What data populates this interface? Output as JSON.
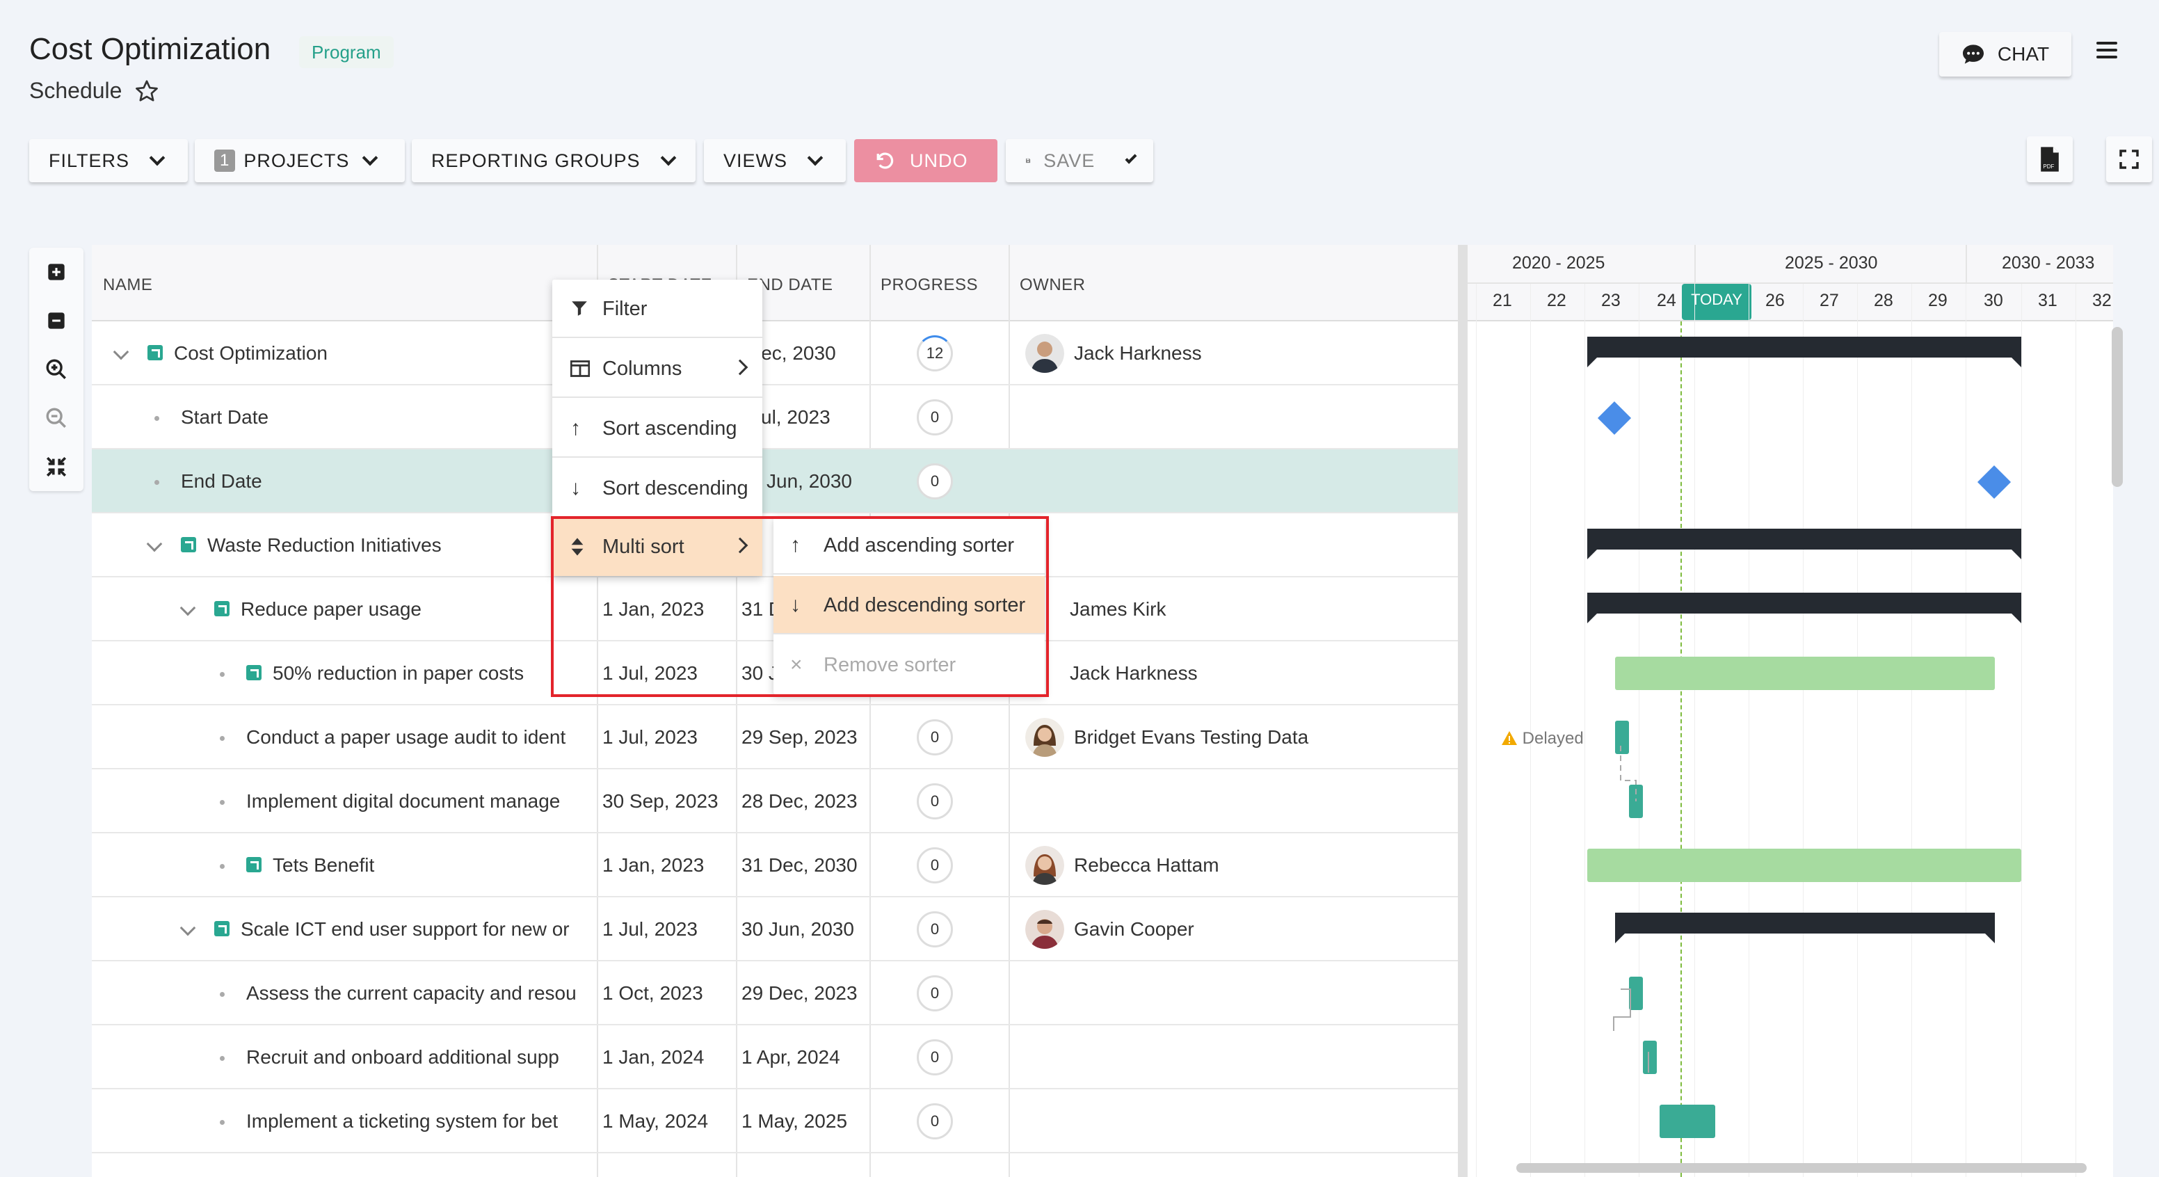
{
  "header": {
    "title": "Cost Optimization",
    "badge": "Program",
    "subtitle": "Schedule",
    "chat_label": "CHAT"
  },
  "toolbar": {
    "filters": "FILTERS",
    "projects_count": "1",
    "projects": "PROJECTS",
    "reporting_groups": "REPORTING GROUPS",
    "views": "VIEWS",
    "undo": "UNDO",
    "save": "SAVE"
  },
  "columns": {
    "name": "NAME",
    "start_date": "START DATE",
    "end_date": "END DATE",
    "progress": "PROGRESS",
    "owner": "OWNER"
  },
  "rows": [
    {
      "name": "Cost Optimization",
      "start": "",
      "end": "Dec, 2030",
      "progress": "12",
      "owner": "Jack Harkness"
    },
    {
      "name": "Start Date",
      "start": "",
      "end": "ul, 2023",
      "progress": "0",
      "owner": ""
    },
    {
      "name": "End Date",
      "start": "",
      "end": "Jun, 2030",
      "progress": "0",
      "owner": ""
    },
    {
      "name": "Waste Reduction Initiatives",
      "start": "",
      "end": "",
      "progress": "",
      "owner": ""
    },
    {
      "name": "Reduce paper usage",
      "start": "1 Jan, 2023",
      "end": "31 D",
      "progress": "",
      "owner": "James Kirk"
    },
    {
      "name": "50% reduction in paper costs",
      "start": "1 Jul, 2023",
      "end": "30 J",
      "progress": "",
      "owner": "Jack Harkness"
    },
    {
      "name": "Conduct a paper usage audit to ident",
      "start": "1 Jul, 2023",
      "end": "29 Sep, 2023",
      "progress": "0",
      "owner": "Bridget Evans Testing Data"
    },
    {
      "name": "Implement digital document manage",
      "start": "30 Sep, 2023",
      "end": "28 Dec, 2023",
      "progress": "0",
      "owner": ""
    },
    {
      "name": "Tets Benefit",
      "start": "1 Jan, 2023",
      "end": "31 Dec, 2030",
      "progress": "0",
      "owner": "Rebecca Hattam"
    },
    {
      "name": "Scale ICT end user support for new or",
      "start": "1 Jul, 2023",
      "end": "30 Jun, 2030",
      "progress": "0",
      "owner": "Gavin Cooper"
    },
    {
      "name": "Assess the current capacity and resou",
      "start": "1 Oct, 2023",
      "end": "29 Dec, 2023",
      "progress": "0",
      "owner": ""
    },
    {
      "name": "Recruit and onboard additional supp",
      "start": "1 Jan, 2024",
      "end": "1 Apr, 2024",
      "progress": "0",
      "owner": ""
    },
    {
      "name": "Implement a ticketing system for bet",
      "start": "1 May, 2024",
      "end": "1 May, 2025",
      "progress": "0",
      "owner": ""
    }
  ],
  "gantt": {
    "periods": [
      "2020 - 2025",
      "2025 - 2030",
      "2030 - 2033"
    ],
    "years": [
      "21",
      "22",
      "23",
      "24",
      "26",
      "27",
      "28",
      "29",
      "30",
      "31",
      "32"
    ],
    "today_label": "TODAY",
    "delayed_label": "Delayed"
  },
  "context_menu": {
    "filter": "Filter",
    "columns": "Columns",
    "sort_ascending": "Sort ascending",
    "sort_descending": "Sort descending",
    "multi_sort": "Multi sort"
  },
  "submenu": {
    "add_ascending": "Add ascending sorter",
    "add_descending": "Add descending sorter",
    "remove": "Remove sorter"
  }
}
